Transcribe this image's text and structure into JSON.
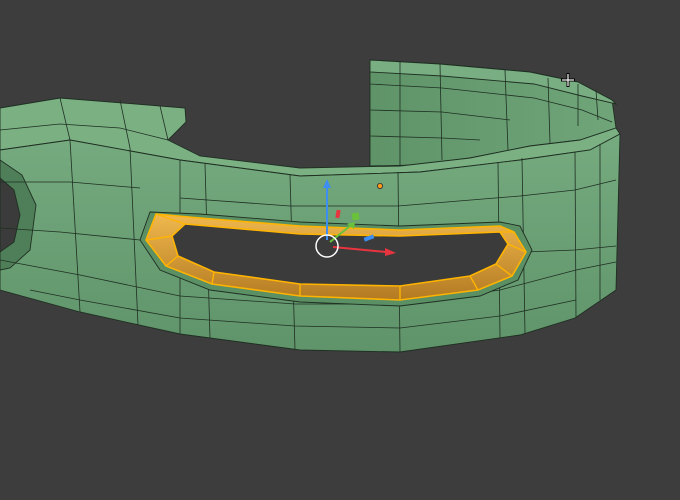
{
  "viewport": {
    "background_color": "#3d3d3d",
    "mode": "edit-mode",
    "mesh_color": "#6a9e74",
    "mesh_top_color": "#74a97d",
    "wire_color": "#1f2f22",
    "selection_color": "#ffb400",
    "selected_face_color": "#e8a63a",
    "pivot_color": "#ff9a1a"
  },
  "gizmo": {
    "x_axis_color": "#e8343f",
    "y_axis_color": "#6ac23a",
    "z_axis_color": "#3d8ef0",
    "plane_color": "#3d8ef0",
    "center_ring_color": "#ffffff"
  },
  "cursor": {
    "icon": "crosshair-icon"
  }
}
